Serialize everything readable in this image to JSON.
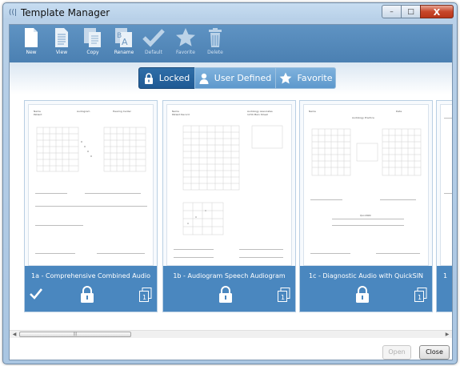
{
  "window": {
    "title": "Template Manager"
  },
  "window_controls": {
    "minimize": "–",
    "maximize": "□",
    "close": "X"
  },
  "toolbar": {
    "new": "New",
    "view": "View",
    "copy": "Copy",
    "rename": "Rename",
    "default": "Default",
    "favorite": "Favorite",
    "delete": "Delete"
  },
  "filters": {
    "locked": "Locked",
    "user_defined": "User Defined",
    "favorite": "Favorite",
    "active": "locked"
  },
  "cards": [
    {
      "name": "1a - Comprehensive Combined Audio",
      "is_default": true,
      "locked": true,
      "copy_badge": "1"
    },
    {
      "name": "1b - Audiogram Speech Audiogram",
      "is_default": false,
      "locked": true,
      "copy_badge": "1"
    },
    {
      "name": "1c - Diagnostic Audio with QuickSIN",
      "is_default": false,
      "locked": true,
      "copy_badge": "1"
    },
    {
      "name": "1"
    }
  ],
  "scrollbar": {
    "thumb_grip": "|||"
  },
  "buttons": {
    "open": "Open",
    "close": "Close"
  },
  "colors": {
    "toolbar": "#4f84b6",
    "active_filter": "#2a68a2",
    "card_caption": "#4a87bf"
  }
}
